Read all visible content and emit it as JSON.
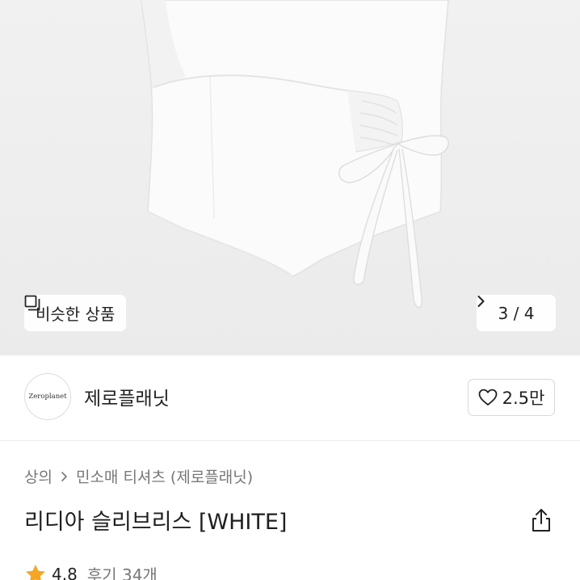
{
  "product_image": {
    "similar_button_label": "비슷한 상품",
    "similar_icon": "similar-items-icon",
    "pager_text": "3 / 4",
    "pager_icon": "chevron-right-icon"
  },
  "shop": {
    "logo_text": "Zeroplanet",
    "name": "제로플래닛",
    "like_count": "2.5만",
    "like_icon": "heart-outline-icon"
  },
  "breadcrumb": {
    "items": [
      "상의",
      "민소매 티셔츠 (제로플래닛)"
    ],
    "separator_icon": "chevron-right-icon"
  },
  "product": {
    "title": "리디아 슬리브리스 [WHITE]",
    "share_icon": "share-icon",
    "rating": "4.8",
    "reviews_label": "후기 34개",
    "star_icon": "star-icon",
    "star_color": "#F5A623"
  }
}
